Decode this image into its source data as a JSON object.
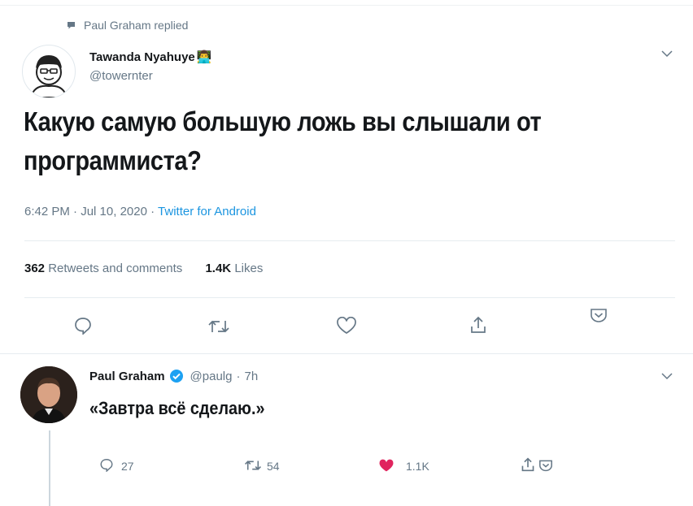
{
  "main_tweet": {
    "context": "Paul Graham replied",
    "author_name": "Tawanda Nyahuye",
    "author_emoji": "👨‍💻",
    "author_handle": "@towernter",
    "text": "Какую самую большую ложь вы слышали от программиста?",
    "time": "6:42 PM",
    "date": "Jul 10, 2020",
    "source": "Twitter for Android",
    "retweets_count": "362",
    "retweets_label": "Retweets and comments",
    "likes_count": "1.4K",
    "likes_label": "Likes"
  },
  "reply_tweet": {
    "author_name": "Paul Graham",
    "author_handle": "@paulg",
    "time_ago": "7h",
    "text": "«Завтра всё сделаю.»",
    "reply_count": "27",
    "retweet_count": "54",
    "like_count": "1.1K"
  },
  "separators": {
    "dot": "·"
  },
  "colors": {
    "link": "#1b95e0",
    "verified": "#1da1f2",
    "like_active": "#e0245e",
    "muted": "#657786",
    "divider": "#e6ecf0"
  },
  "icons": [
    "speech-bubble-icon",
    "chevron-down-icon",
    "reply-icon",
    "retweet-icon",
    "heart-icon",
    "share-icon",
    "bookmark-pocket-icon",
    "verified-badge-icon"
  ]
}
